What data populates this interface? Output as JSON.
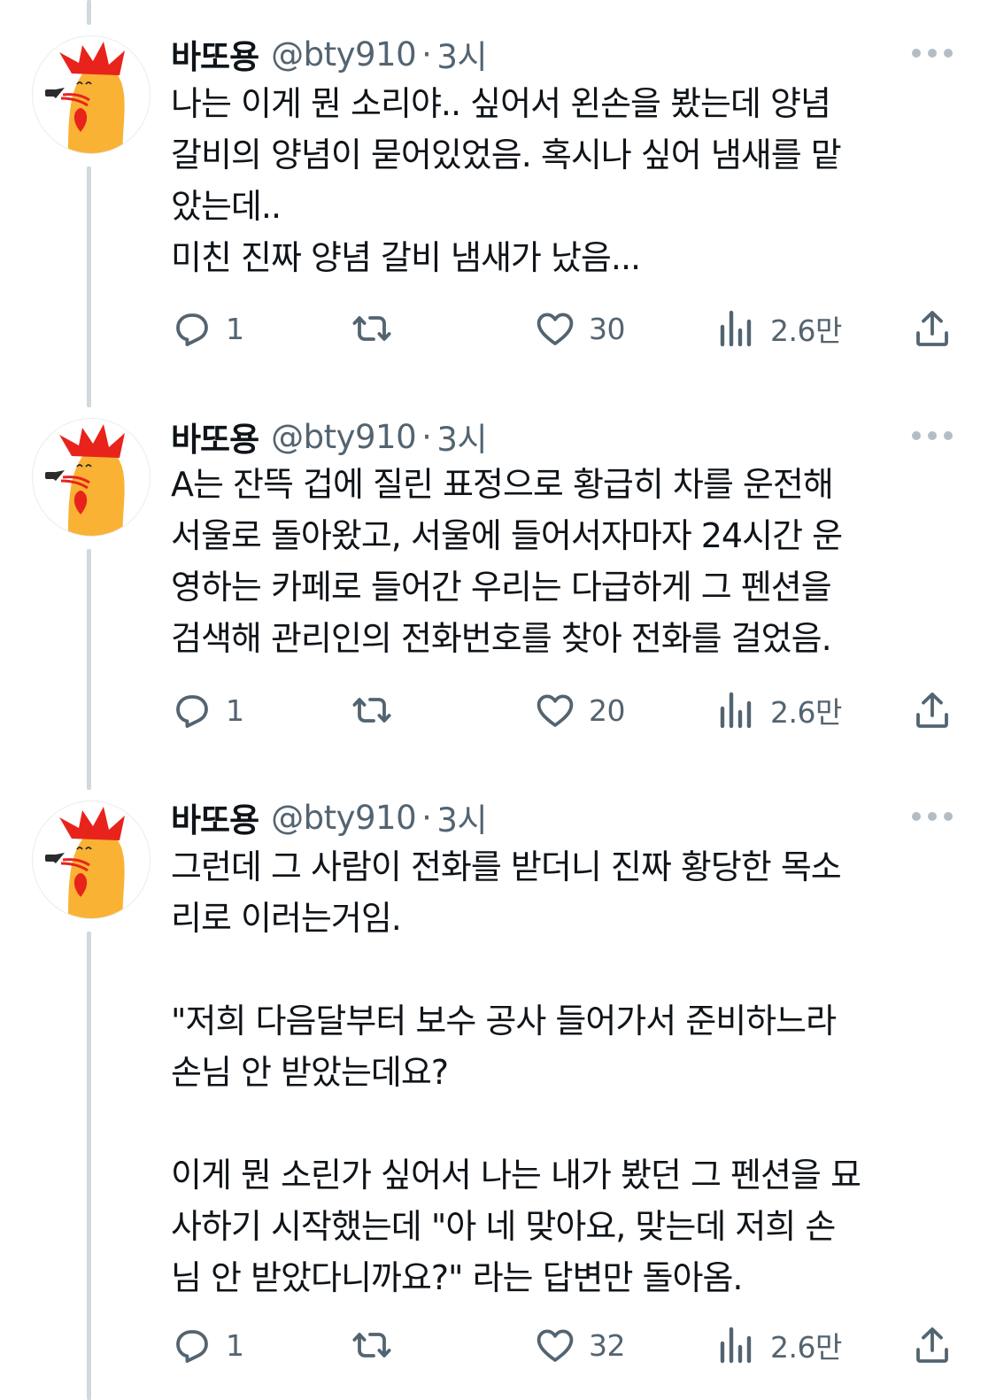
{
  "tweets": [
    {
      "name": "바또용",
      "handle": "@bty910",
      "separator": "·",
      "time": "3시",
      "lines": [
        "나는 이게 뭔 소리야.. 싶어서 왼손을 봤는데 양념",
        "갈비의 양념이 묻어있었음. 혹시나 싶어 냄새를 맡",
        "았는데..",
        "미친 진짜 양념 갈비 냄새가 났음..."
      ],
      "replies": "1",
      "retweets": "",
      "likes": "30",
      "views": "2.6만"
    },
    {
      "name": "바또용",
      "handle": "@bty910",
      "separator": "·",
      "time": "3시",
      "lines": [
        "A는 잔뜩 겁에 질린 표정으로 황급히 차를 운전해",
        "서울로 돌아왔고, 서울에 들어서자마자 24시간 운",
        "영하는 카페로 들어간 우리는 다급하게 그 펜션을",
        "검색해 관리인의 전화번호를 찾아 전화를 걸었음."
      ],
      "replies": "1",
      "retweets": "",
      "likes": "20",
      "views": "2.6만"
    },
    {
      "name": "바또용",
      "handle": "@bty910",
      "separator": "·",
      "time": "3시",
      "lines": [
        "그런데 그 사람이 전화를 받더니 진짜 황당한 목소",
        "리로 이러는거임.",
        "",
        "\"저희 다음달부터 보수 공사 들어가서 준비하느라",
        "손님 안 받았는데요?",
        "",
        "이게 뭔 소린가 싶어서 나는 내가 봤던 그 펜션을 묘",
        "사하기 시작했는데 \"아 네 맞아요, 맞는데 저희 손",
        "님 안 받았다니까요?\" 라는 답변만 돌아옴."
      ],
      "replies": "1",
      "retweets": "",
      "likes": "32",
      "views": "2.6만"
    }
  ],
  "icons": {
    "reply": "reply-icon",
    "retweet": "retweet-icon",
    "like": "heart-icon",
    "views": "views-icon",
    "share": "share-icon",
    "more": "more-icon"
  },
  "colors": {
    "text": "#0f1419",
    "secondary": "#536471",
    "thread_line": "#cfd9de",
    "avatar_red": "#e8231c",
    "avatar_yellow": "#f9b233"
  }
}
